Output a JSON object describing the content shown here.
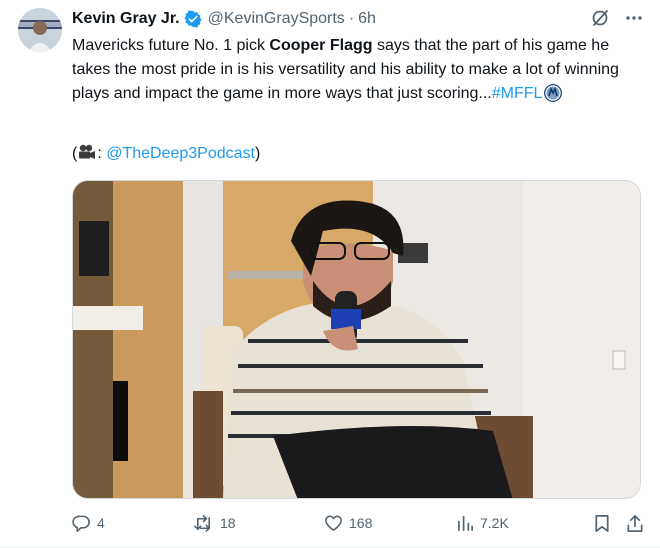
{
  "author": {
    "name": "Kevin Gray Jr.",
    "handle": "@KevinGraySports",
    "separator": "·",
    "time": "6h",
    "verified": true
  },
  "tweet": {
    "text_part1": "Mavericks future No. 1 pick ",
    "text_bold": "Cooper Flagg",
    "text_part2": " says that the part of his game he takes the most pride in is his versatility and his ability to make a lot of winning plays and impact the game in more ways that just scoring...",
    "hashtag": "#MFFL",
    "credit_open": "(",
    "credit_suffix": ": ",
    "credit_handle": "@TheDeep3Podcast",
    "credit_close": ")"
  },
  "actions": {
    "replies": "4",
    "reposts": "18",
    "likes": "168",
    "views": "7.2K"
  },
  "colors": {
    "accent": "#1d9bf0",
    "secondary_text": "#536471",
    "primary_text": "#0f1419"
  },
  "icons": {
    "verified": "verified-badge-icon",
    "grok": "grok-icon",
    "more": "more-icon",
    "reply": "reply-icon",
    "repost": "repost-icon",
    "like": "heart-icon",
    "views": "views-icon",
    "bookmark": "bookmark-icon",
    "share": "share-icon",
    "camera": "movie-camera-icon",
    "mavs_logo": "mavericks-logo-icon"
  }
}
